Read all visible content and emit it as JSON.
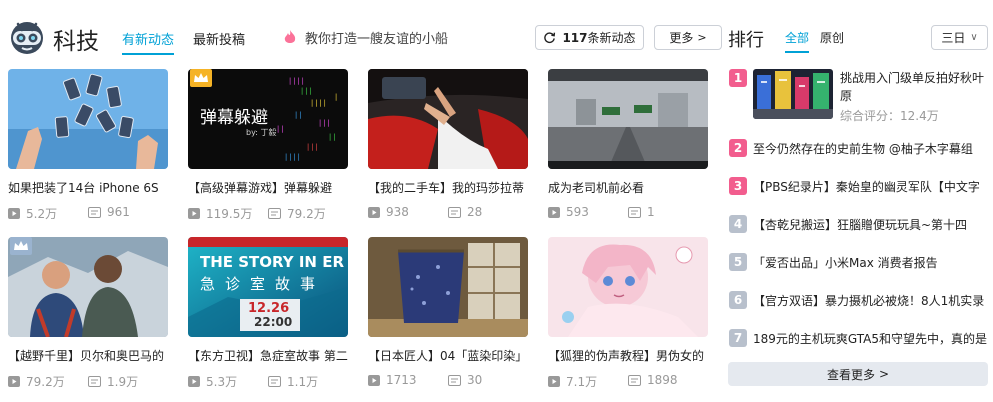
{
  "header": {
    "section_title": "科技",
    "tabs": [
      {
        "label": "有新动态",
        "active": true
      },
      {
        "label": "最新投稿",
        "active": false
      }
    ],
    "promo_text": "教你打造一艘友谊的小船",
    "refresh_count": "117",
    "refresh_suffix": "条新动态",
    "more_label": "更多"
  },
  "videos": [
    {
      "title": "如果把装了14台 iPhone 6S",
      "plays": "5.2万",
      "danmaku": "961",
      "thumb": "hands-phones",
      "crown": false
    },
    {
      "title": "【高级弹幕游戏】弹幕躲避",
      "plays": "119.5万",
      "danmaku": "79.2万",
      "thumb": "danmaku-game",
      "crown": true,
      "thumb_text": "弹幕躲避",
      "thumb_sub": "by: 丁毅"
    },
    {
      "title": "【我的二手车】我的玛莎拉蒂",
      "plays": "938",
      "danmaku": "28",
      "thumb": "car-interior",
      "crown": false
    },
    {
      "title": "成为老司机前必看",
      "plays": "593",
      "danmaku": "1",
      "thumb": "dashcam-road",
      "crown": false
    },
    {
      "title": "【越野千里】贝尔和奥巴马的",
      "plays": "79.2万",
      "danmaku": "1.9万",
      "thumb": "two-men-outdoor",
      "crown": true
    },
    {
      "title": "【东方卫视】急症室故事 第二",
      "plays": "5.3万",
      "danmaku": "1.1万",
      "thumb": "er-story",
      "crown": false,
      "thumb_text": "THE STORY IN ER",
      "thumb_sub": "急诊室故事",
      "thumb_date": "12.26",
      "thumb_time": "22:00"
    },
    {
      "title": "【日本匠人】04「蓝染印染」",
      "plays": "1713",
      "danmaku": "30",
      "thumb": "indigo-kimono",
      "crown": false
    },
    {
      "title": "【狐狸的伪声教程】男伪女的",
      "plays": "7.1万",
      "danmaku": "1898",
      "thumb": "anime-girl",
      "crown": false
    }
  ],
  "ranking": {
    "title": "排行",
    "tabs": [
      {
        "label": "全部",
        "active": true
      },
      {
        "label": "原创",
        "active": false
      }
    ],
    "range": "三日",
    "items": [
      {
        "rank": "1",
        "title": "挑战用入门级单反拍好秋叶原",
        "score": "综合评分：12.4万"
      },
      {
        "rank": "2",
        "title": "至今仍然存在的史前生物 @柚子木字幕组"
      },
      {
        "rank": "3",
        "title": "【PBS纪录片】秦始皇的幽灵军队【中文字"
      },
      {
        "rank": "4",
        "title": "【杏乾兒搬运】狂腦贈便玩玩具~第十四"
      },
      {
        "rank": "5",
        "title": "「爱否出品」小米Max 消费者报告"
      },
      {
        "rank": "6",
        "title": "【官方双语】暴力摄机必被烧！8人1机实录"
      },
      {
        "rank": "7",
        "title": "189元的主机玩爽GTA5和守望先中，真的是"
      }
    ],
    "view_more": "查看更多"
  },
  "colors": {
    "accent": "#00a1d6",
    "rank_top": "#f25d8e",
    "rank_other": "#b8c0cc",
    "promo_icon": "#fb7299"
  }
}
